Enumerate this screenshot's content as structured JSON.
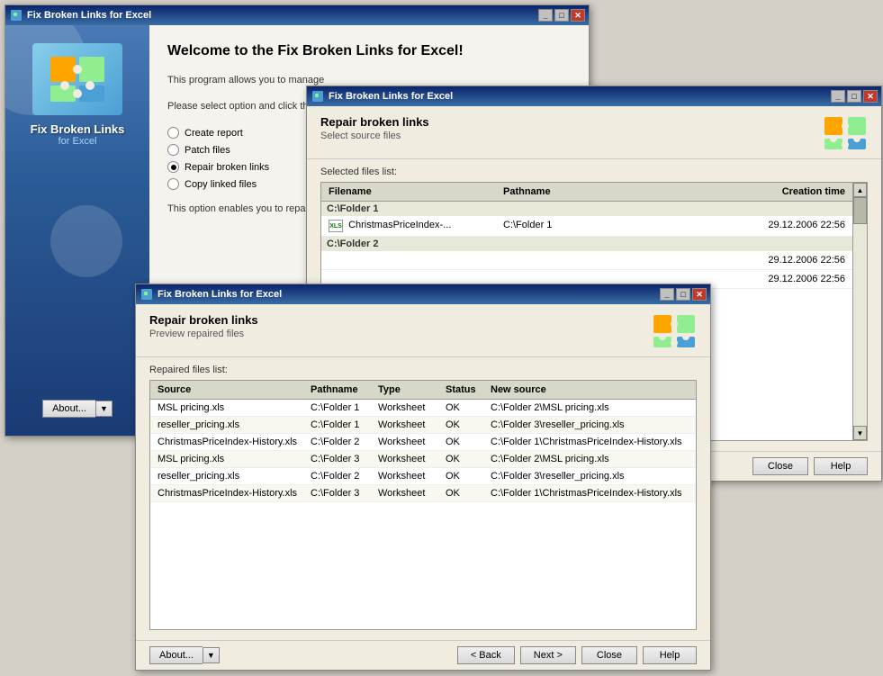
{
  "main_window": {
    "title": "Fix Broken Links for Excel",
    "sidebar": {
      "app_name_line1": "Fix Broken Links",
      "app_name_line2": "for Excel",
      "about_btn": "About..."
    },
    "content": {
      "welcome_title": "Welcome to the Fix Broken Links for Excel!",
      "description": "This program allows you to manage",
      "select_prompt": "Please select option and click the",
      "options": [
        {
          "id": "create-report",
          "label": "Create report",
          "selected": false
        },
        {
          "id": "patch-files",
          "label": "Patch files",
          "selected": false
        },
        {
          "id": "repair-broken-links",
          "label": "Repair broken links",
          "selected": true
        },
        {
          "id": "copy-linked-files",
          "label": "Copy linked files",
          "selected": false
        }
      ],
      "option_desc": "This option enables you to repai"
    }
  },
  "second_window": {
    "title": "Fix Broken Links for Excel",
    "header_title": "Repair broken links",
    "header_sub": "Select source files",
    "section_label": "Selected files list:",
    "columns": [
      "Filename",
      "Pathname",
      "Creation time"
    ],
    "folders": [
      {
        "name": "C:\\Folder 1",
        "files": [
          {
            "filename": "ChristmasPriceIndex-...",
            "pathname": "C:\\Folder 1",
            "creation": "29.12.2006 22:56"
          }
        ]
      },
      {
        "name": "C:\\Folder 2",
        "files": [
          {
            "filename": "",
            "pathname": "",
            "creation": "29.12.2006 22:56"
          }
        ]
      },
      {
        "name": "",
        "files": [
          {
            "filename": "",
            "pathname": "",
            "creation": "29.12.2006 22:56"
          }
        ]
      }
    ],
    "buttons": [
      "Close",
      "Help"
    ]
  },
  "third_window": {
    "title": "Fix Broken Links for Excel",
    "header_title": "Repair broken links",
    "header_sub": "Preview repaired files",
    "section_label": "Repaired files list:",
    "columns": [
      "Source",
      "Pathname",
      "Type",
      "Status",
      "New source"
    ],
    "rows": [
      {
        "source": "MSL pricing.xls",
        "pathname": "C:\\Folder 1",
        "type": "Worksheet",
        "status": "OK",
        "newsource": "C:\\Folder 2\\MSL pricing.xls"
      },
      {
        "source": "reseller_pricing.xls",
        "pathname": "C:\\Folder 1",
        "type": "Worksheet",
        "status": "OK",
        "newsource": "C:\\Folder 3\\reseller_pricing.xls"
      },
      {
        "source": "ChristmasPriceIndex-History.xls",
        "pathname": "C:\\Folder 2",
        "type": "Worksheet",
        "status": "OK",
        "newsource": "C:\\Folder 1\\ChristmasPriceIndex-History.xls"
      },
      {
        "source": "MSL pricing.xls",
        "pathname": "C:\\Folder 3",
        "type": "Worksheet",
        "status": "OK",
        "newsource": "C:\\Folder 2\\MSL pricing.xls"
      },
      {
        "source": "reseller_pricing.xls",
        "pathname": "C:\\Folder 2",
        "type": "Worksheet",
        "status": "OK",
        "newsource": "C:\\Folder 3\\reseller_pricing.xls"
      },
      {
        "source": "ChristmasPriceIndex-History.xls",
        "pathname": "C:\\Folder 3",
        "type": "Worksheet",
        "status": "OK",
        "newsource": "C:\\Folder 1\\ChristmasPriceIndex-History.xls"
      }
    ],
    "buttons": {
      "about": "About...",
      "back": "< Back",
      "next": "Next >",
      "close": "Close",
      "help": "Help"
    }
  }
}
